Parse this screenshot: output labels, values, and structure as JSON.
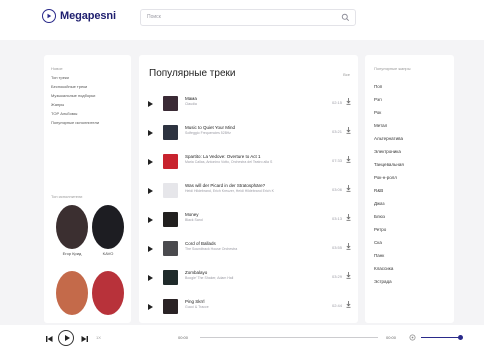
{
  "header": {
    "logo_text": "Megapesni",
    "search_placeholder": "Поиск"
  },
  "left_nav": {
    "items": [
      "Новое",
      "Топ треки",
      "Беспокойные треки",
      "Музыкальные подборки",
      "Жанры",
      "TOP Альбомы",
      "Популярные исполнители"
    ]
  },
  "artists": {
    "title": "Топ исполнители",
    "items": [
      {
        "name": "Егор Крид",
        "color": "#3b2f30"
      },
      {
        "name": "KAVO",
        "color": "#1d1d22"
      },
      {
        "name": "",
        "color": "#c46a4a"
      },
      {
        "name": "",
        "color": "#b8323a"
      }
    ]
  },
  "main": {
    "title": "Популярные треки",
    "all_link": "Все",
    "tracks": [
      {
        "title": "Мама",
        "artist": "Claudia",
        "duration": "02:15",
        "cover": "#3a2a35"
      },
      {
        "title": "Music to Quiet Your Mind",
        "artist": "Solfeggio Frequencies 528Hz",
        "duration": "03:21",
        "cover": "#2d3340"
      },
      {
        "title": "Spartito: La Vedove: Overture to Act 1",
        "artist": "Maria Callas, Antonino Votto, Orchestra del Teatro alla S",
        "duration": "07:33",
        "cover": "#c8232e"
      },
      {
        "title": "Was will der Picard in der Stratosphäre?",
        "artist": "Heidi Hildebrand, Erich Kreuzer, Heidi Hildebrand Erich K",
        "duration": "03:06",
        "cover": "#e6e6ea"
      },
      {
        "title": "Money",
        "artist": "Black Sand",
        "duration": "03:13",
        "cover": "#22201f"
      },
      {
        "title": "Cord of Ballads",
        "artist": "The Soundtrack House Orchestra",
        "duration": "03:55",
        "cover": "#4a4a4e"
      },
      {
        "title": "Zombalayo",
        "artist": "Boogie' The Shaker, Adam Hall",
        "duration": "03:29",
        "cover": "#1f2a2a"
      },
      {
        "title": "Ping Skrrl",
        "artist": "Gucci & Tracce",
        "duration": "02:44",
        "cover": "#2a2325"
      }
    ]
  },
  "genres": {
    "title": "Популярные жанры",
    "items": [
      "Поп",
      "Рэп",
      "Рок",
      "Метал",
      "Альтернатива",
      "Электроника",
      "Танцевальная",
      "Рок-н-ролл",
      "R&B",
      "Джаз",
      "Блюз",
      "Ретро",
      "Ска",
      "Панк",
      "Классика",
      "Эстрада"
    ]
  },
  "player": {
    "speed": "1X",
    "current_time": "00:00",
    "total_time": "00:00",
    "progress": 0.0,
    "volume": 1.0
  }
}
